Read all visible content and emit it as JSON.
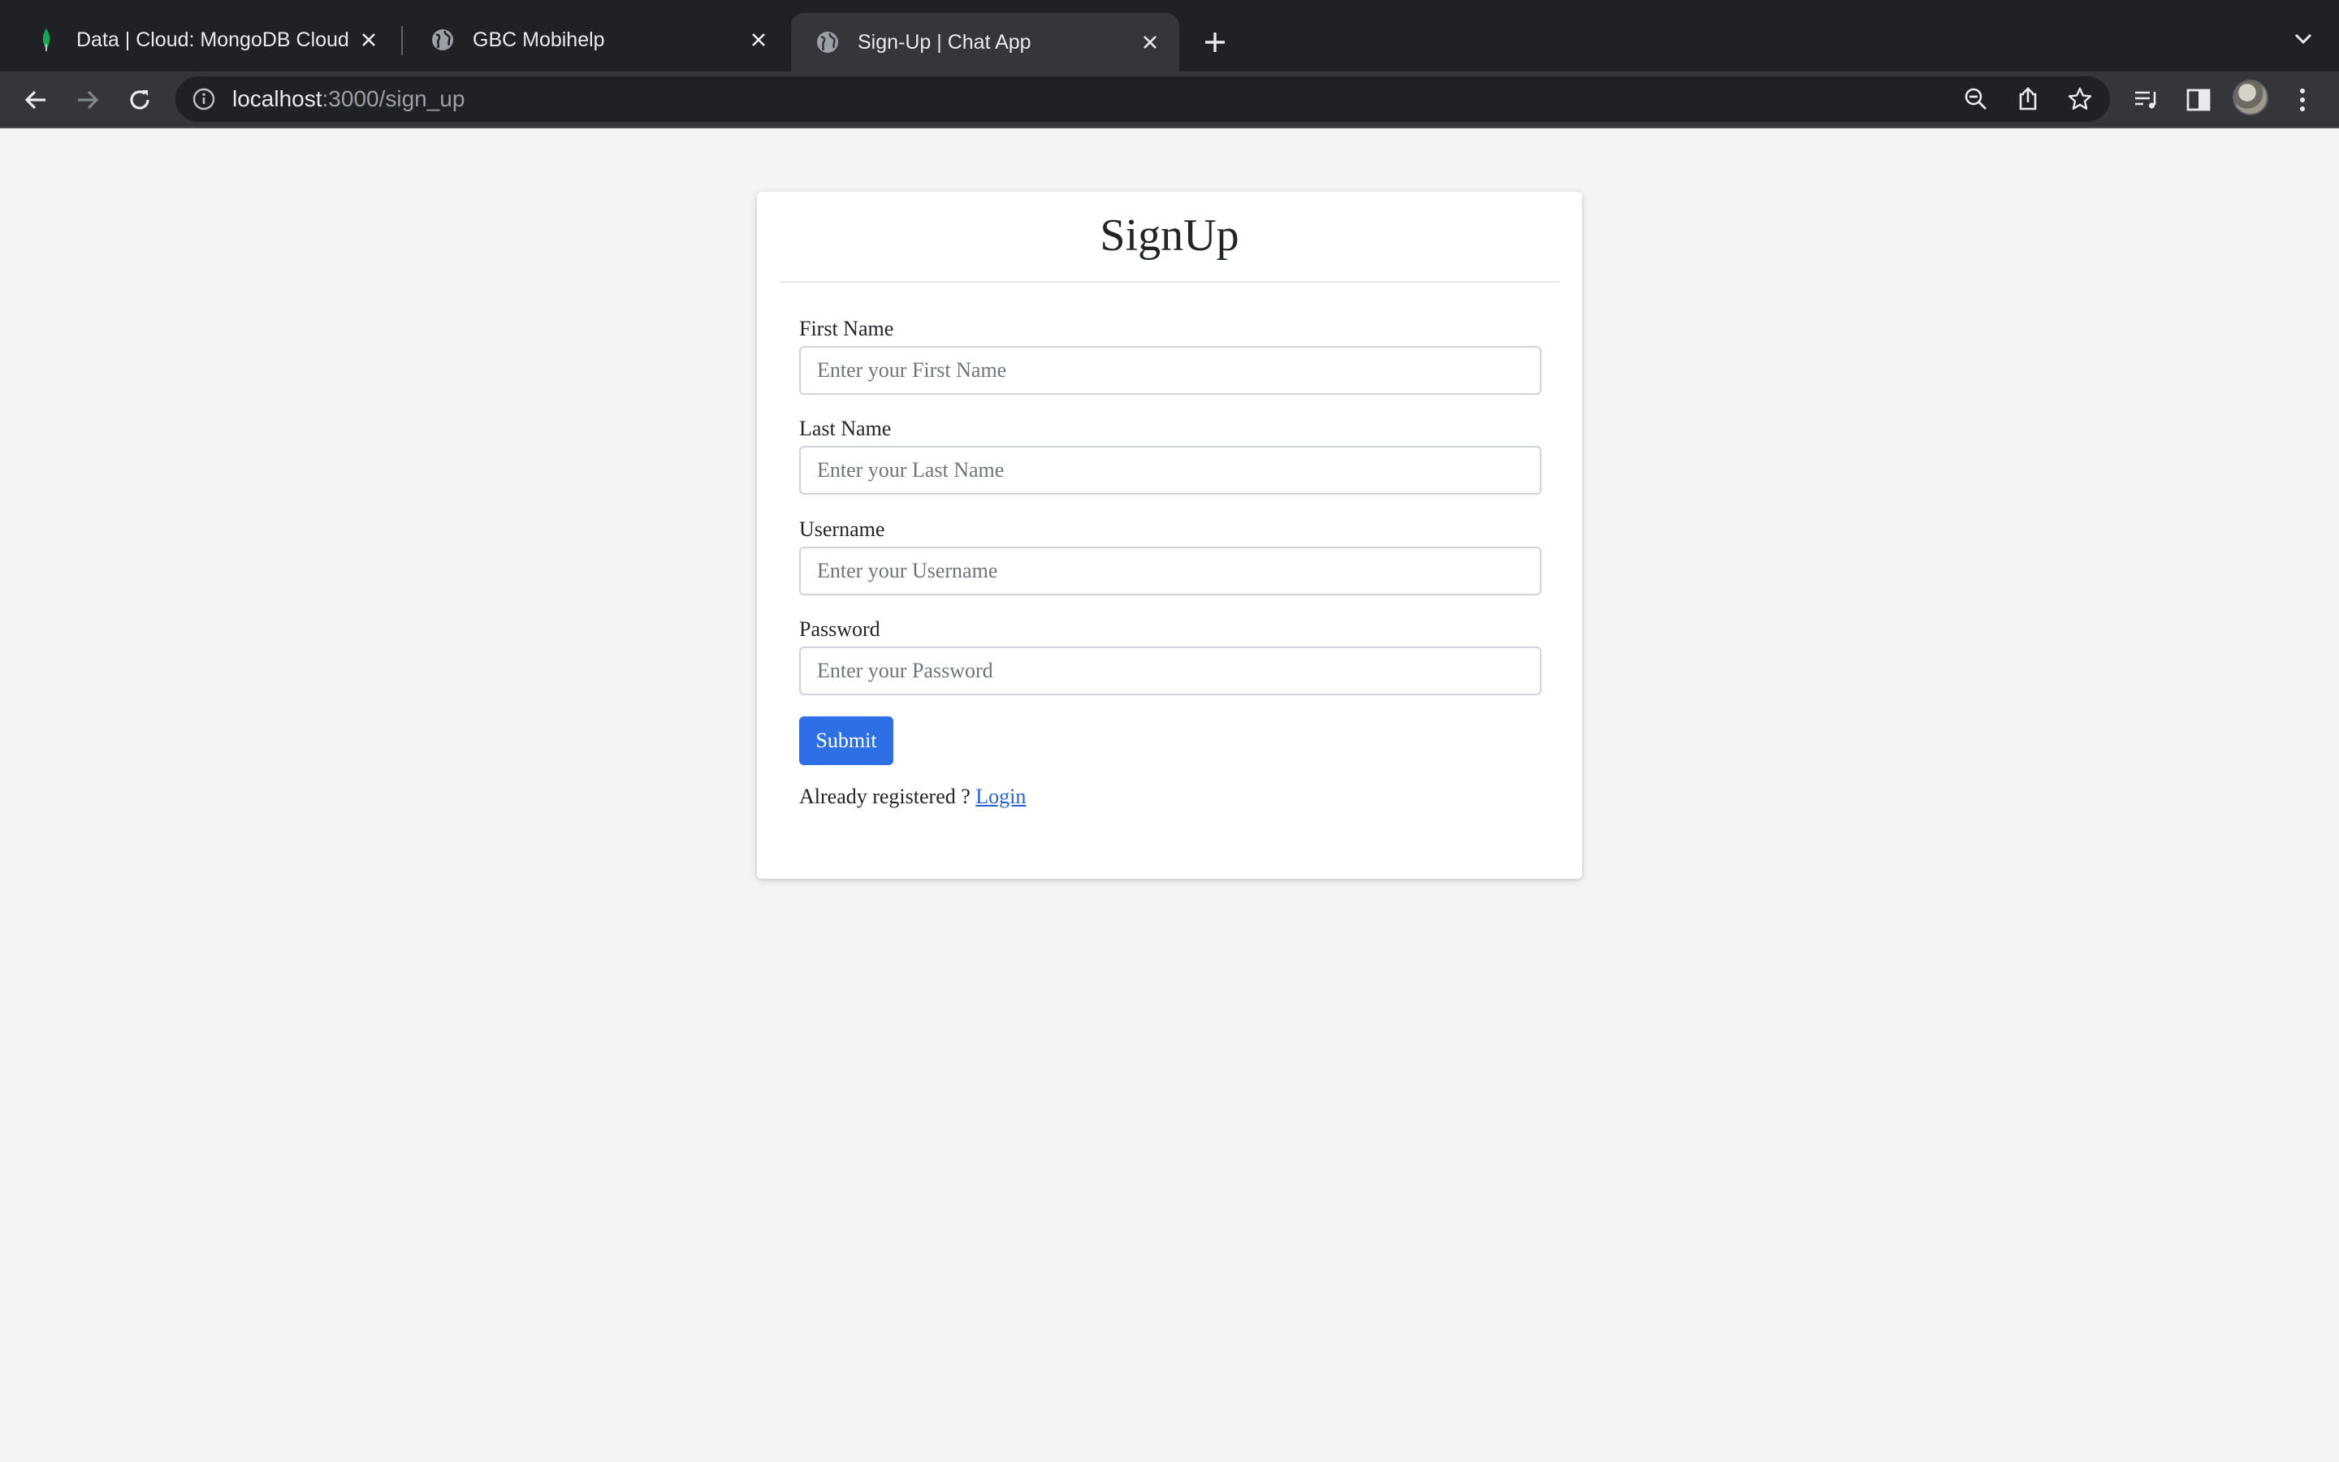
{
  "browser": {
    "tabs": [
      {
        "title": "Data | Cloud: MongoDB Cloud",
        "icon": "mongodb-leaf-icon",
        "active": false
      },
      {
        "title": "GBC Mobihelp",
        "icon": "globe-icon",
        "active": false
      },
      {
        "title": "Sign-Up | Chat App",
        "icon": "globe-icon",
        "active": true
      }
    ],
    "url_host": "localhost",
    "url_rest": ":3000/sign_up"
  },
  "form": {
    "title": "SignUp",
    "fields": [
      {
        "label": "First Name",
        "placeholder": "Enter your First Name",
        "value": ""
      },
      {
        "label": "Last Name",
        "placeholder": "Enter your Last Name",
        "value": ""
      },
      {
        "label": "Username",
        "placeholder": "Enter your Username",
        "value": ""
      },
      {
        "label": "Password",
        "placeholder": "Enter your Password",
        "value": ""
      }
    ],
    "submit_label": "Submit",
    "already_text": "Already registered ?",
    "login_label": "Login"
  },
  "colors": {
    "page_background": "#f4f4f4",
    "submit_button": "#2f6fe6",
    "link": "#2563d9",
    "browser_frame": "#202124",
    "browser_toolbar": "#35363a"
  }
}
